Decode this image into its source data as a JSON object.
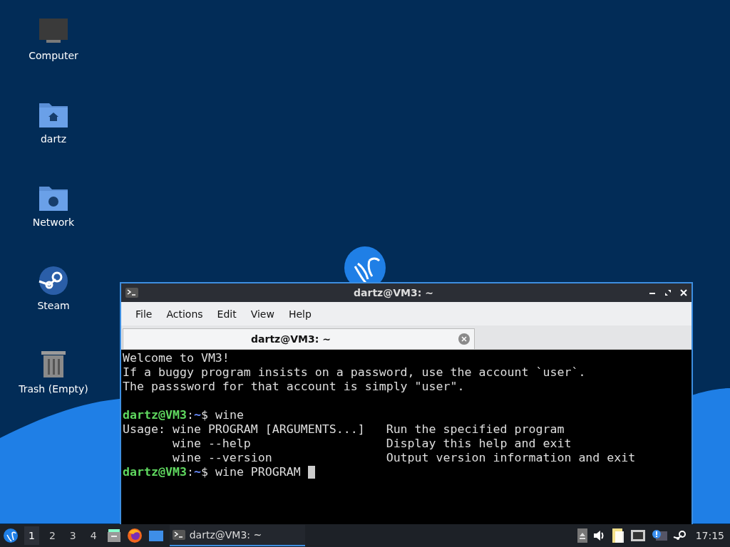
{
  "desktop_icons": [
    {
      "kind": "computer",
      "label": "Computer"
    },
    {
      "kind": "home",
      "label": "dartz"
    },
    {
      "kind": "network",
      "label": "Network"
    },
    {
      "kind": "steam",
      "label": "Steam"
    },
    {
      "kind": "trash",
      "label": "Trash (Empty)"
    }
  ],
  "terminal": {
    "title": "dartz@VM3: ~",
    "menu": [
      "File",
      "Actions",
      "Edit",
      "View",
      "Help"
    ],
    "tabs": [
      {
        "label": "dartz@VM3: ~",
        "selected": true
      }
    ],
    "lines": [
      {
        "kind": "text",
        "text": "Welcome to VM3!"
      },
      {
        "kind": "text",
        "text": "If a buggy program insists on a password, use the account `user`."
      },
      {
        "kind": "text",
        "text": "The passsword for that account is simply \"user\"."
      },
      {
        "kind": "blank"
      },
      {
        "kind": "prompt",
        "user": "dartz@VM3",
        "separator": ":",
        "path": "~",
        "symbol": "$",
        "command": "wine",
        "cursor": false
      },
      {
        "kind": "text",
        "text": "Usage: wine PROGRAM [ARGUMENTS...]   Run the specified program"
      },
      {
        "kind": "text",
        "text": "       wine --help                   Display this help and exit"
      },
      {
        "kind": "text",
        "text": "       wine --version                Output version information and exit"
      },
      {
        "kind": "prompt",
        "user": "dartz@VM3",
        "separator": ":",
        "path": "~",
        "symbol": "$",
        "command": "wine PROGRAM",
        "cursor": true
      }
    ]
  },
  "taskbar": {
    "workspaces": [
      {
        "label": "1",
        "selected": true
      },
      {
        "label": "2",
        "selected": false
      },
      {
        "label": "3",
        "selected": false
      },
      {
        "label": "4",
        "selected": false
      }
    ],
    "tasks": [
      {
        "label": "dartz@VM3: ~",
        "selected": true
      }
    ],
    "clock": "17:15"
  }
}
